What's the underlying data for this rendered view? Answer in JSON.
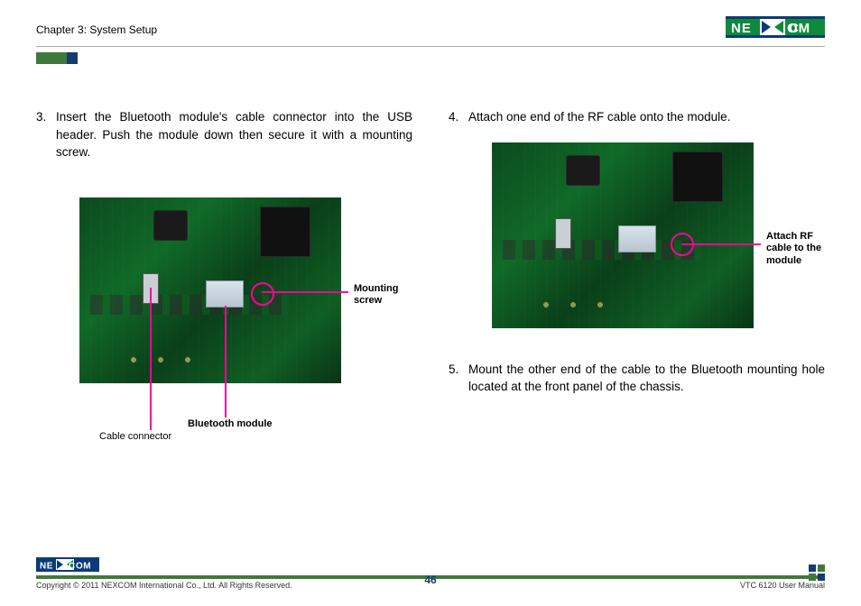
{
  "header": {
    "chapter": "Chapter 3: System Setup"
  },
  "brand": {
    "name": "NEXCOM"
  },
  "steps": {
    "s3_num": "3.",
    "s3_text": "Insert the Bluetooth module's cable connector into the USB header. Push the module down then secure it with a mounting screw.",
    "s4_num": "4.",
    "s4_text": "Attach one end of the RF cable onto the module.",
    "s5_num": "5.",
    "s5_text": "Mount the other end of the cable to the Bluetooth mounting hole located at the front panel of the chassis."
  },
  "callouts": {
    "mounting_screw": "Mounting screw",
    "bluetooth_module": "Bluetooth module",
    "cable_connector": "Cable connector",
    "attach_rf": "Attach RF cable to the module"
  },
  "footer": {
    "copyright": "Copyright © 2011 NEXCOM International Co., Ltd. All Rights Reserved.",
    "page": "46",
    "doc": "VTC 6120 User Manual"
  }
}
